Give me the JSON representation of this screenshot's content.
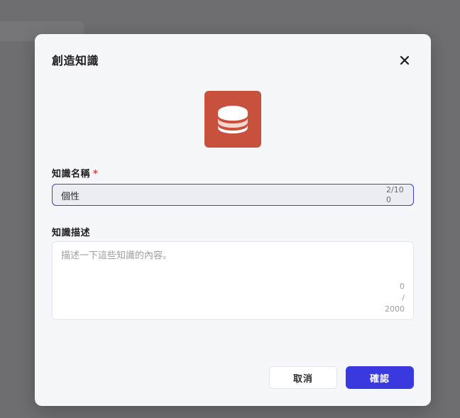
{
  "modal": {
    "title": "創造知識",
    "close_icon": "close-icon",
    "app_icon": "database-icon",
    "app_icon_color": "#c8513d"
  },
  "form": {
    "name_label": "知識名稱",
    "required_mark": "*",
    "name_value": "個性",
    "name_count": "2/100",
    "desc_label": "知識描述",
    "desc_placeholder": "描述一下這些知識的內容。",
    "desc_count_current": "0",
    "desc_count_sep": "/",
    "desc_count_max": "2000"
  },
  "footer": {
    "cancel_label": "取消",
    "confirm_label": "確認",
    "confirm_color": "#3a39e0"
  }
}
